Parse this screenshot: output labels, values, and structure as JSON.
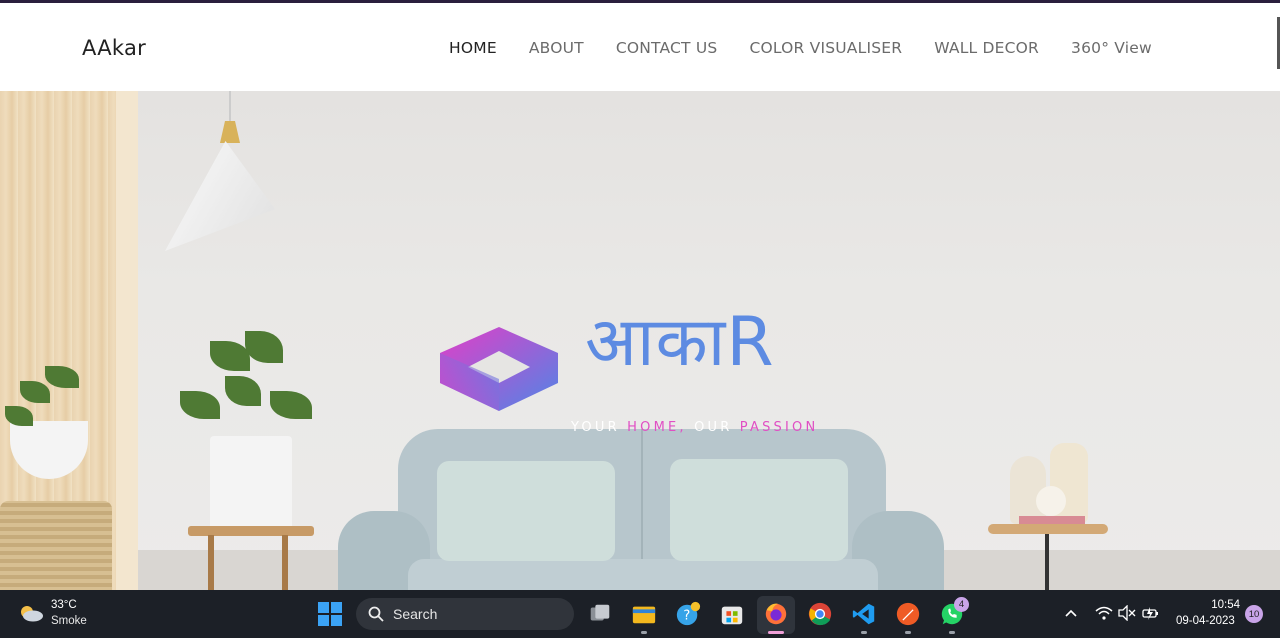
{
  "site": {
    "brand": "AAkar",
    "nav": [
      {
        "label": "HOME",
        "active": true
      },
      {
        "label": "ABOUT",
        "active": false
      },
      {
        "label": "CONTACT US",
        "active": false
      },
      {
        "label": "COLOR VISUALISER",
        "active": false
      },
      {
        "label": "WALL DECOR",
        "active": false
      },
      {
        "label": "360° View",
        "active": false
      }
    ]
  },
  "hero": {
    "logo_text": "आकाR",
    "tagline_1": "YOUR ",
    "tagline_2": "HOME,",
    "tagline_3": " OUR ",
    "tagline_4": "PASSION",
    "logo_colors": {
      "magenta": "#e23ec7",
      "blue": "#4f86e6"
    }
  },
  "taskbar": {
    "weather_temp": "33°C",
    "weather_cond": "Smoke",
    "search_label": "Search",
    "whatsapp_badge": "4",
    "time": "10:54",
    "date": "09-04-2023",
    "notifications": "10",
    "apps": [
      "start-icon",
      "task-view-icon",
      "file-explorer-icon",
      "help-icon",
      "store-icon",
      "firefox-icon",
      "chrome-icon",
      "vscode-icon",
      "postman-icon",
      "whatsapp-icon"
    ]
  }
}
